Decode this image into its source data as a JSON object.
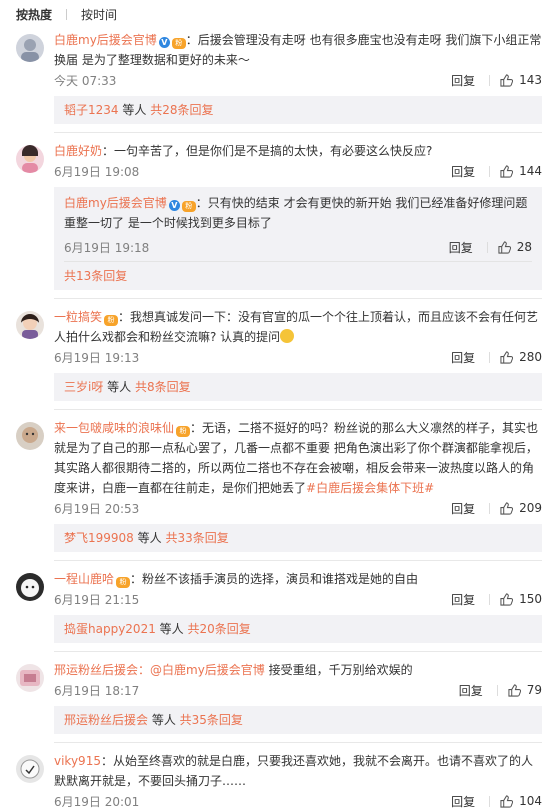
{
  "sort": {
    "hot": "按热度",
    "time": "按时间"
  },
  "reply_label": "回复",
  "comments": [
    {
      "user": "白鹿my后援会官博",
      "verified": true,
      "text": "：后援会管理没有走呀 也有很多鹿宝也没有走呀 我们旗下小组正常换届 是为了整理数据和更好的未来～",
      "time": "今天 07:33",
      "likes": "143",
      "more_user": "韬子1234",
      "more_mid": " 等人 ",
      "more_count": "共28条回复"
    },
    {
      "user": "白鹿好奶",
      "text": "：一句辛苦了，但是你们是不是搞的太快，有必要这么快反应?",
      "time": "6月19日 19:08",
      "likes": "144",
      "sub": {
        "user": "白鹿my后援会官博",
        "text": "：只有快的结束 才会有更快的新开始 我们已经准备好修理问题重整一切了 是一个时候找到更多目标了",
        "time": "6月19日 19:18",
        "likes": "28"
      },
      "more_count": "共13条回复"
    },
    {
      "user": "一粒搞笑",
      "text": "：我想真诚发问一下：没有官宣的瓜一个个往上顶着认，而且应该不会有任何艺人拍什么戏都会和粉丝交流嘛? 认真的提问",
      "time": "6月19日 19:13",
      "likes": "280",
      "more_user": "三岁i呀",
      "more_mid": " 等人 ",
      "more_count": "共8条回复"
    },
    {
      "user": "来一包啵咸味的浪味仙",
      "text": "：无语，二搭不挺好的吗？粉丝说的那么大义凛然的样子，其实也就是为了自己的那一点私心罢了，几番一点都不重要 把角色演出彩了你个群演都能拿视后，其实路人都很期待二搭的，所以两位二搭也不存在会被嘲，相反会带来一波热度以路人的角度来讲，白鹿一直都在往前走，是你们把她丢了",
      "hashtag": "#白鹿后援会集体下班#",
      "time": "6月19日 20:53",
      "likes": "209",
      "more_user": "梦飞199908",
      "more_mid": " 等人 ",
      "more_count": "共33条回复"
    },
    {
      "user": "一程山鹿哈",
      "text": "：粉丝不该插手演员的选择，演员和谁搭戏是她的自由",
      "time": "6月19日 21:15",
      "likes": "150",
      "more_user": "捣蛋happy2021",
      "more_mid": " 等人 ",
      "more_count": "共20条回复"
    },
    {
      "user": "邢运粉丝后援会",
      "mention": "：@白鹿my后援会官博",
      "text": " 接受重组，千万别给欢娱的",
      "time": "6月19日 18:17",
      "likes": "79",
      "more_user": "邢运粉丝后援会",
      "more_mid": " 等人 ",
      "more_count": "共35条回复"
    },
    {
      "user": "viky915",
      "text": "：从始至终喜欢的就是白鹿，只要我还喜欢她，我就不会离开。也请不喜欢了的人默默离开就是，不要回头捅刀子……",
      "time": "6月19日 20:01",
      "likes": "104"
    }
  ],
  "colors": {
    "username": "#eb7350",
    "subbox": "#f2f2f5",
    "verified": "#2f87e0"
  }
}
